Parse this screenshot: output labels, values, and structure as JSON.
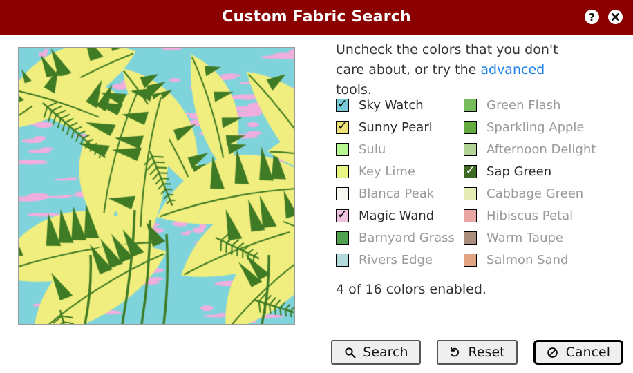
{
  "window": {
    "title": "Custom Fabric Search",
    "titlebar_color": "#8b0000",
    "help_icon": "help-circle-icon",
    "close_icon": "close-circle-icon"
  },
  "preview": {
    "alt": "tropical banana leaf fabric swatch",
    "palette": {
      "sky": "#7fd4dc",
      "pink": "#efaede",
      "leaf_yellow": "#f0ee7e",
      "dark_green": "#3f7a24"
    }
  },
  "intro": {
    "before_link": "Uncheck the colors that you don't care about, or try the ",
    "link_text": "advanced",
    "link_color": "#1a7fe8",
    "after_link": " tools."
  },
  "colors": [
    {
      "label": "Sky Watch",
      "hex": "#77cad8",
      "checked": true,
      "check_color": "#000000"
    },
    {
      "label": "Green Flash",
      "hex": "#77bd5e",
      "checked": false,
      "check_color": "#000000"
    },
    {
      "label": "Sunny Pearl",
      "hex": "#f0e277",
      "checked": true,
      "check_color": "#000000"
    },
    {
      "label": "Sparkling Apple",
      "hex": "#63ab3c",
      "checked": false,
      "check_color": "#000000"
    },
    {
      "label": "Sulu",
      "hex": "#b6f78f",
      "checked": false,
      "check_color": "#000000"
    },
    {
      "label": "Afternoon Delight",
      "hex": "#b3d396",
      "checked": false,
      "check_color": "#000000"
    },
    {
      "label": "Key Lime",
      "hex": "#e8f582",
      "checked": false,
      "check_color": "#000000"
    },
    {
      "label": "Sap Green",
      "hex": "#3d6b26",
      "checked": true,
      "check_color": "#ffffff"
    },
    {
      "label": "Blanca Peak",
      "hex": "#f5f7f0",
      "checked": false,
      "check_color": "#000000"
    },
    {
      "label": "Cabbage Green",
      "hex": "#e5ecb5",
      "checked": false,
      "check_color": "#000000"
    },
    {
      "label": "Magic Wand",
      "hex": "#f0c3e0",
      "checked": true,
      "check_color": "#000000"
    },
    {
      "label": "Hibiscus Petal",
      "hex": "#eaa5a5",
      "checked": false,
      "check_color": "#000000"
    },
    {
      "label": "Barnyard Grass",
      "hex": "#4fa14f",
      "checked": false,
      "check_color": "#000000"
    },
    {
      "label": "Warm Taupe",
      "hex": "#ab8e7e",
      "checked": false,
      "check_color": "#000000"
    },
    {
      "label": "Rivers Edge",
      "hex": "#b3dbdb",
      "checked": false,
      "check_color": "#000000"
    },
    {
      "label": "Salmon Sand",
      "hex": "#e2a584",
      "checked": false,
      "check_color": "#000000"
    }
  ],
  "status": {
    "text": "4 of 16 colors enabled.",
    "enabled_count": 4,
    "total_count": 16
  },
  "buttons": [
    {
      "label": "Search",
      "icon": "magnifier-icon",
      "focused": false
    },
    {
      "label": "Reset",
      "icon": "undo-arrow-icon",
      "focused": false
    },
    {
      "label": "Cancel",
      "icon": "no-entry-icon",
      "focused": true
    }
  ]
}
